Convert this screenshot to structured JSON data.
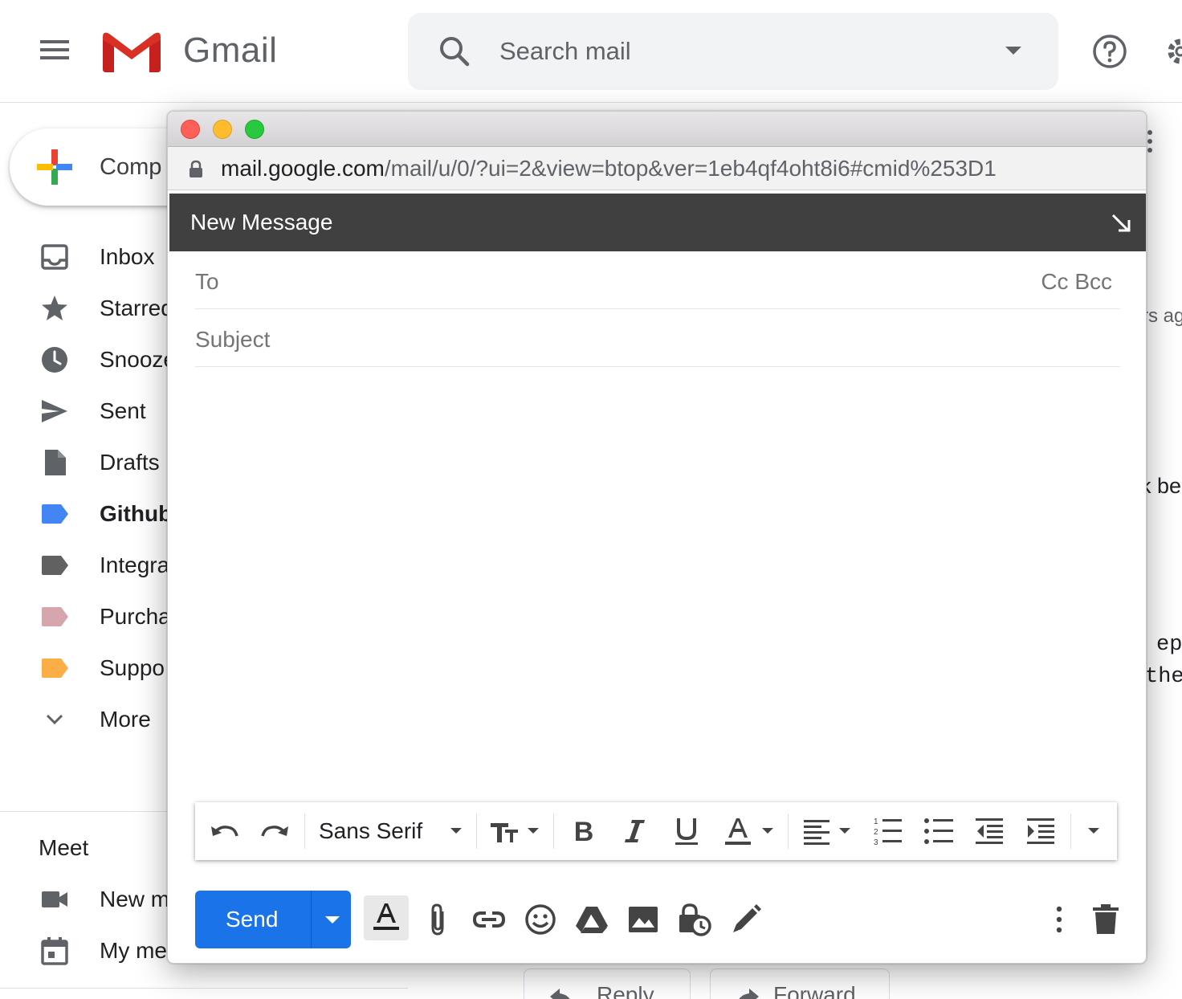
{
  "header": {
    "app_name": "Gmail",
    "search_placeholder": "Search mail"
  },
  "sidebar": {
    "compose_label": "Comp",
    "items": [
      {
        "label": "Inbox",
        "icon": "inbox-icon"
      },
      {
        "label": "Starred",
        "icon": "star-icon"
      },
      {
        "label": "Snoozed",
        "icon": "clock-icon"
      },
      {
        "label": "Sent",
        "icon": "send-icon"
      },
      {
        "label": "Drafts",
        "icon": "draft-icon"
      },
      {
        "label": "Github",
        "icon": "label-icon",
        "color": "#4285f4",
        "bold": true
      },
      {
        "label": "Integra",
        "icon": "label-icon",
        "color": "#616161"
      },
      {
        "label": "Purcha",
        "icon": "label-icon",
        "color": "#d5a6ac"
      },
      {
        "label": "Suppo",
        "icon": "label-icon",
        "color": "#fbad48"
      },
      {
        "label": "More",
        "icon": "chevron-down-icon"
      }
    ],
    "meet": {
      "title": "Meet",
      "items": [
        {
          "label": "New m",
          "icon": "video-icon"
        },
        {
          "label": "My me",
          "icon": "calendar-icon"
        }
      ]
    }
  },
  "background": {
    "fragments": [
      "rs ag",
      "k be",
      "ep",
      "the"
    ],
    "reply_label": "Reply",
    "forward_label": "Forward"
  },
  "popup": {
    "url_host": "mail.google.com",
    "url_path": "/mail/u/0/?ui=2&view=btop&ver=1eb4qf4oht8i6#cmid%253D1",
    "title": "New Message",
    "to_label": "To",
    "cc_bcc_label": "Cc Bcc",
    "subject_placeholder": "Subject",
    "toolbar": {
      "font": "Sans Serif"
    },
    "send_label": "Send"
  },
  "colors": {
    "accent": "#1a73e8",
    "compose_header": "#404040"
  }
}
